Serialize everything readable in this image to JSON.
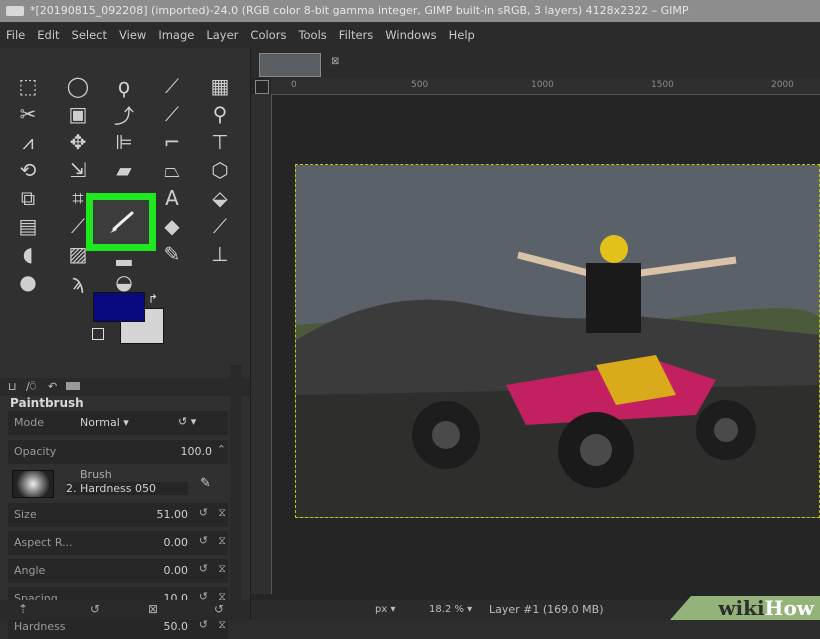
{
  "window": {
    "title": "*[20190815_092208] (imported)-24.0 (RGB color 8-bit gamma integer, GIMP built-in sRGB, 3 layers) 4128x2322 – GIMP"
  },
  "menubar": [
    "File",
    "Edit",
    "Select",
    "View",
    "Image",
    "Layer",
    "Colors",
    "Tools",
    "Filters",
    "Windows",
    "Help"
  ],
  "tool_options": {
    "title": "Paintbrush",
    "mode_label": "Mode",
    "mode_value": "Normal",
    "opacity_label": "Opacity",
    "opacity_value": "100.0",
    "brush_label": "Brush",
    "brush_name": "2. Hardness 050",
    "rows": [
      {
        "label": "Size",
        "value": "51.00"
      },
      {
        "label": "Aspect R...",
        "value": "0.00"
      },
      {
        "label": "Angle",
        "value": "0.00"
      },
      {
        "label": "Spacing",
        "value": "10.0"
      },
      {
        "label": "Hardness",
        "value": "50.0"
      }
    ]
  },
  "ruler": {
    "marks": [
      "0",
      "500",
      "1000",
      "1500",
      "2000"
    ]
  },
  "status": {
    "unit": "px",
    "zoom": "18.2 %",
    "layer_info": "Layer #1 (169.0 MB)"
  },
  "watermark": {
    "part1": "wiki",
    "part2": "How"
  },
  "colors": {
    "highlight": "#1ee81e",
    "foreground": "#0a0a80",
    "background": "#d4d4d4"
  }
}
